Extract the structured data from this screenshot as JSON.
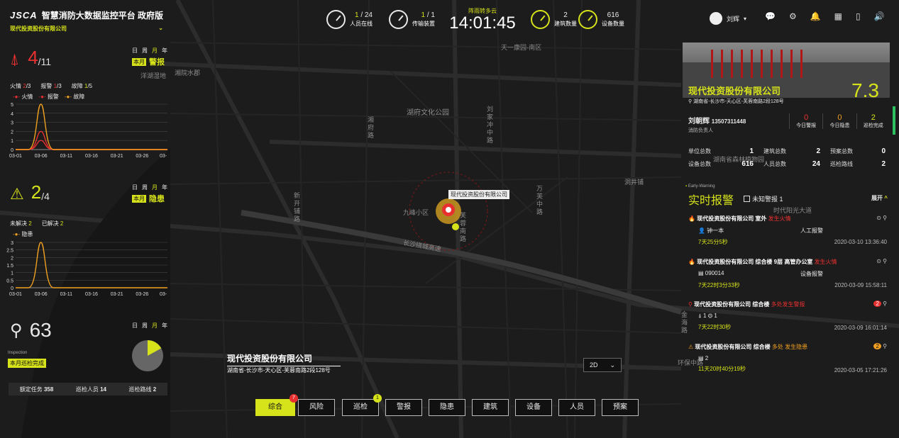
{
  "app": {
    "logo": "JSCA",
    "title": "智慧消防大数据监控平台 政府版",
    "company": "现代投资股份有限公司"
  },
  "top_stats": [
    {
      "value": "1",
      "total": "/ 24",
      "label": "人员在线"
    },
    {
      "value": "1",
      "total": "/ 1",
      "label": "传输装置"
    },
    {
      "value": "2",
      "total": "",
      "label": "建筑数量"
    },
    {
      "value": "616",
      "total": "",
      "label": "设备数量"
    }
  ],
  "clock": {
    "weather": "阵雨转多云",
    "time": "14:01:45"
  },
  "user": {
    "name": "刘辉"
  },
  "alarm_panel": {
    "value": "4",
    "total": "/11",
    "period_tabs": [
      "日",
      "周",
      "月",
      "年"
    ],
    "period_active": "本月",
    "title": "警报",
    "stats": [
      {
        "label": "火情",
        "value": "2",
        "total": "/3"
      },
      {
        "label": "报警",
        "value": "1",
        "total": "/3"
      },
      {
        "label": "故障",
        "value": "1",
        "total": "/5"
      }
    ],
    "legend": [
      "火情",
      "报警",
      "故障"
    ]
  },
  "hazard_panel": {
    "value": "2",
    "total": "/4",
    "period_tabs": [
      "日",
      "周",
      "月",
      "年"
    ],
    "period_active": "本月",
    "title": "隐患",
    "stats": [
      {
        "label": "未解决",
        "value": "2"
      },
      {
        "label": "已解决",
        "value": "2"
      }
    ],
    "legend": [
      "隐患"
    ]
  },
  "inspection_panel": {
    "value": "63",
    "period_tabs": [
      "日",
      "周",
      "月",
      "年"
    ],
    "label_en": "Inspection",
    "label": "本月巡检完成",
    "footer": [
      {
        "label": "额定任务",
        "value": "358"
      },
      {
        "label": "巡检人员",
        "value": "14"
      },
      {
        "label": "巡检路线",
        "value": "2"
      }
    ],
    "pie_fraction": 0.17
  },
  "chart_data": [
    {
      "type": "line",
      "x": [
        "03-01",
        "03-06",
        "03-11",
        "03-16",
        "03-21",
        "03-26",
        "03-"
      ],
      "ylim": [
        0,
        5
      ],
      "yticks": [
        "0",
        "1",
        "2",
        "3",
        "4",
        "5"
      ],
      "series": [
        {
          "name": "火情",
          "color": "#e83030",
          "peak_x": 1.0,
          "peak_y": 2
        },
        {
          "name": "报警",
          "color": "#e83030",
          "peak_x": 1.0,
          "peak_y": 1
        },
        {
          "name": "故障",
          "color": "#f0a020",
          "peak_x": 1.0,
          "peak_y": 5
        }
      ]
    },
    {
      "type": "line",
      "x": [
        "03-01",
        "03-06",
        "03-11",
        "03-16",
        "03-21",
        "03-26",
        "03-"
      ],
      "ylim": [
        0,
        3
      ],
      "yticks": [
        "0",
        "0.5",
        "1",
        "1.5",
        "2",
        "2.5",
        "3"
      ],
      "series": [
        {
          "name": "隐患",
          "color": "#f0a020",
          "peak_x": 1.0,
          "peak_y": 3
        }
      ]
    }
  ],
  "map": {
    "labels": [
      "湖府文化公园",
      "九峰小区",
      "天一康园-南区",
      "洋湖湿地",
      "湘院水郡",
      "新开铺路",
      "万芙中路",
      "芙蓉南路",
      "长沙绕城高速",
      "湖南省森林植物园",
      "环保中路",
      "金海路",
      "洞井铺",
      "时代阳光大道",
      "湘府路",
      "二线",
      "纪念九七",
      "刘家冲中路",
      "长沙绕城高速"
    ],
    "marker_label": "现代投资股份有限公司",
    "info_name": "现代投资股份有限公司",
    "info_address": "湖南省-长沙市-天心区-芙蓉南路2段128号",
    "view_mode": "2D"
  },
  "nav_buttons": [
    {
      "label": "综合",
      "active": true,
      "badge": "7",
      "badge_color": "#e83030"
    },
    {
      "label": "风险",
      "active": false
    },
    {
      "label": "巡检",
      "active": false,
      "badge": "1",
      "badge_color": "#d6e21a"
    },
    {
      "label": "警报",
      "active": false
    },
    {
      "label": "隐患",
      "active": false
    },
    {
      "label": "建筑",
      "active": false
    },
    {
      "label": "设备",
      "active": false
    },
    {
      "label": "人员",
      "active": false
    },
    {
      "label": "预案",
      "active": false
    }
  ],
  "company_card": {
    "name": "现代投资股份有限公司",
    "score": "7.3",
    "address": "湖南省-长沙市-天心区-芙蓉南路2段128号",
    "person": "刘朝辉",
    "phone": "13507311448",
    "role": "消防负责人",
    "kpis": [
      {
        "value": "0",
        "label": "今日警报"
      },
      {
        "value": "0",
        "label": "今日隐患"
      },
      {
        "value": "2",
        "label": "巡检完成"
      }
    ],
    "stats": [
      {
        "label": "单位总数",
        "value": "1"
      },
      {
        "label": "建筑总数",
        "value": "2"
      },
      {
        "label": "预案总数",
        "value": "0"
      },
      {
        "label": "设备总数",
        "value": "616"
      },
      {
        "label": "人员总数",
        "value": "24"
      },
      {
        "label": "巡检路线",
        "value": "2"
      }
    ]
  },
  "realtime": {
    "en": "Early-Warning",
    "title": "实时报警",
    "unknown": "未知警报 1",
    "expand": "展开",
    "events": [
      {
        "title": "现代投资股份有限公司 室外",
        "tag": "发生火情",
        "who": "钟一本",
        "src": "人工报警",
        "dur": "7天25分5秒",
        "time": "2020-03-10 13:36:40"
      },
      {
        "title": "现代投资股份有限公司 综合楼 9层 高管办公室",
        "tag": "发生火情",
        "who": "090014",
        "src": "设备报警",
        "dur": "7天22时3分33秒",
        "time": "2020-03-09 15:58:11"
      },
      {
        "title": "现代投资股份有限公司 综合楼",
        "tag": "多处发生警报",
        "who": "1",
        "src": "1",
        "dur": "7天22时30秒",
        "time": "2020-03-09 16:01:14",
        "badge": "2"
      },
      {
        "title": "现代投资股份有限公司 综合楼",
        "tag": "多处 发生隐患",
        "who": "2",
        "src": "",
        "dur": "11天20时40分19秒",
        "time": "2020-03-05 17:21:26",
        "badge": "2"
      }
    ]
  },
  "colors": {
    "accent": "#d6e21a",
    "danger": "#e83030",
    "warn": "#f0a020",
    "bg": "#1b1b1b"
  }
}
